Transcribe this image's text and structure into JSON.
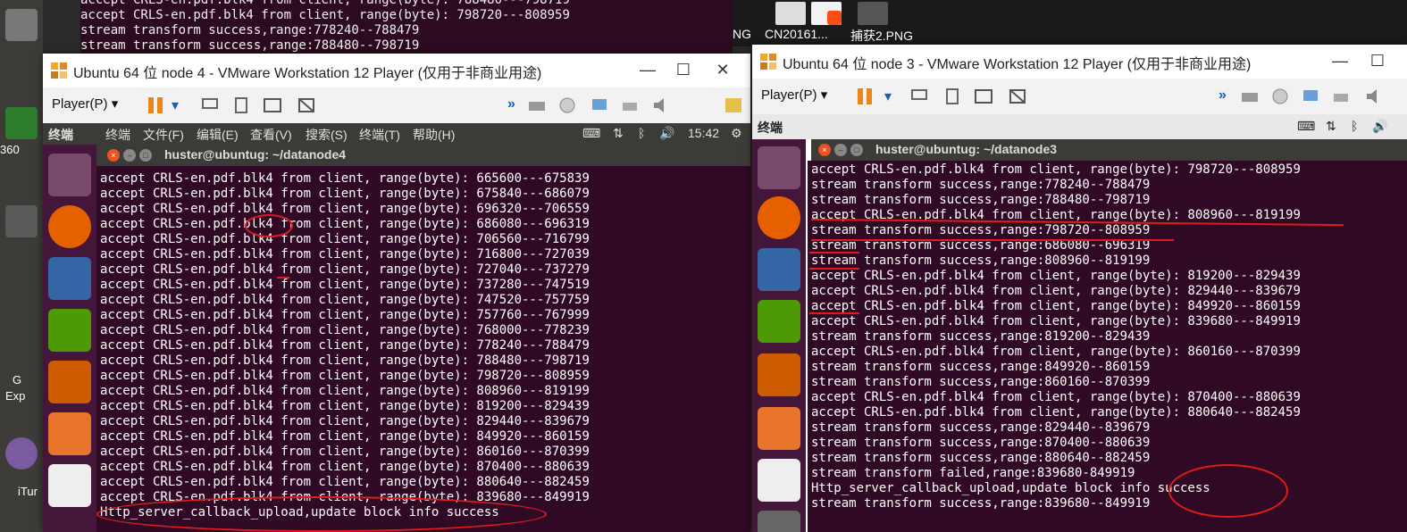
{
  "desktop": {
    "bg_terminal_lines": [
      "accept CRLS-en.pdf.blk4 from client, range(byte): 788480---798719",
      "accept CRLS-en.pdf.blk4 from client, range(byte): 798720---808959",
      "stream transform success,range:778240--788479",
      "stream transform success,range:788480--798719"
    ],
    "left_labels": [
      "360",
      "G",
      "Exp",
      "iTur"
    ],
    "file_labels": [
      "NG",
      "CN20161...",
      "捕获2.PNG"
    ]
  },
  "vm4": {
    "title": "Ubuntu 64 位 node 4 - VMware Workstation 12 Player (仅用于非商业用途)",
    "player_menu": "Player(P)",
    "panel_app": "终端",
    "menus": [
      "终端",
      "文件(F)",
      "编辑(E)",
      "查看(V)",
      "搜索(S)",
      "终端(T)",
      "帮助(H)"
    ],
    "clock": "15:42",
    "terminal_title": "huster@ubuntug: ~/datanode4",
    "lines": [
      "accept CRLS-en.pdf.blk4 from client, range(byte): 665600---675839",
      "accept CRLS-en.pdf.blk4 from client, range(byte): 675840---686079",
      "accept CRLS-en.pdf.blk4 from client, range(byte): 696320---706559",
      "accept CRLS-en.pdf.blk4 from client, range(byte): 686080---696319",
      "accept CRLS-en.pdf.blk4 from client, range(byte): 706560---716799",
      "accept CRLS-en.pdf.blk4 from client, range(byte): 716800---727039",
      "accept CRLS-en.pdf.blk4 from client, range(byte): 727040---737279",
      "accept CRLS-en.pdf.blk4 from client, range(byte): 737280---747519",
      "accept CRLS-en.pdf.blk4 from client, range(byte): 747520---757759",
      "accept CRLS-en.pdf.blk4 from client, range(byte): 757760---767999",
      "accept CRLS-en.pdf.blk4 from client, range(byte): 768000---778239",
      "accept CRLS-en.pdf.blk4 from client, range(byte): 778240---788479",
      "accept CRLS-en.pdf.blk4 from client, range(byte): 788480---798719",
      "accept CRLS-en.pdf.blk4 from client, range(byte): 798720---808959",
      "accept CRLS-en.pdf.blk4 from client, range(byte): 808960---819199",
      "accept CRLS-en.pdf.blk4 from client, range(byte): 819200---829439",
      "accept CRLS-en.pdf.blk4 from client, range(byte): 829440---839679",
      "accept CRLS-en.pdf.blk4 from client, range(byte): 849920---860159",
      "accept CRLS-en.pdf.blk4 from client, range(byte): 860160---870399",
      "accept CRLS-en.pdf.blk4 from client, range(byte): 870400---880639",
      "accept CRLS-en.pdf.blk4 from client, range(byte): 880640---882459",
      "accept CRLS-en.pdf.blk4 from client, range(byte): 839680---849919",
      "Http_server_callback_upload,update block info success"
    ]
  },
  "vm3": {
    "title": "Ubuntu 64 位 node 3 - VMware Workstation 12 Player (仅用于非商业用途)",
    "player_menu": "Player(P)",
    "panel_app": "终端",
    "terminal_title": "huster@ubuntug: ~/datanode3",
    "lines": [
      "accept CRLS-en.pdf.blk4 from client, range(byte): 798720---808959",
      "stream transform success,range:778240--788479",
      "stream transform success,range:788480--798719",
      "accept CRLS-en.pdf.blk4 from client, range(byte): 808960---819199",
      "stream transform success,range:798720--808959",
      "stream transform success,range:686080--696319",
      "stream transform success,range:808960--819199",
      "accept CRLS-en.pdf.blk4 from client, range(byte): 819200---829439",
      "accept CRLS-en.pdf.blk4 from client, range(byte): 829440---839679",
      "accept CRLS-en.pdf.blk4 from client, range(byte): 849920---860159",
      "accept CRLS-en.pdf.blk4 from client, range(byte): 839680---849919",
      "stream transform success,range:819200--829439",
      "accept CRLS-en.pdf.blk4 from client, range(byte): 860160---870399",
      "stream transform success,range:849920--860159",
      "stream transform success,range:860160--870399",
      "accept CRLS-en.pdf.blk4 from client, range(byte): 870400---880639",
      "accept CRLS-en.pdf.blk4 from client, range(byte): 880640---882459",
      "stream transform success,range:829440--839679",
      "stream transform success,range:870400--880639",
      "stream transform success,range:880640--882459",
      "stream transform failed,range:839680-849919",
      "Http_server_callback_upload,update block info success",
      "stream transform success,range:839680--849919"
    ]
  },
  "colors": {
    "terminal_bg": "#300a24",
    "annotation": "#e01b1b",
    "panel": "#3c3b37"
  }
}
